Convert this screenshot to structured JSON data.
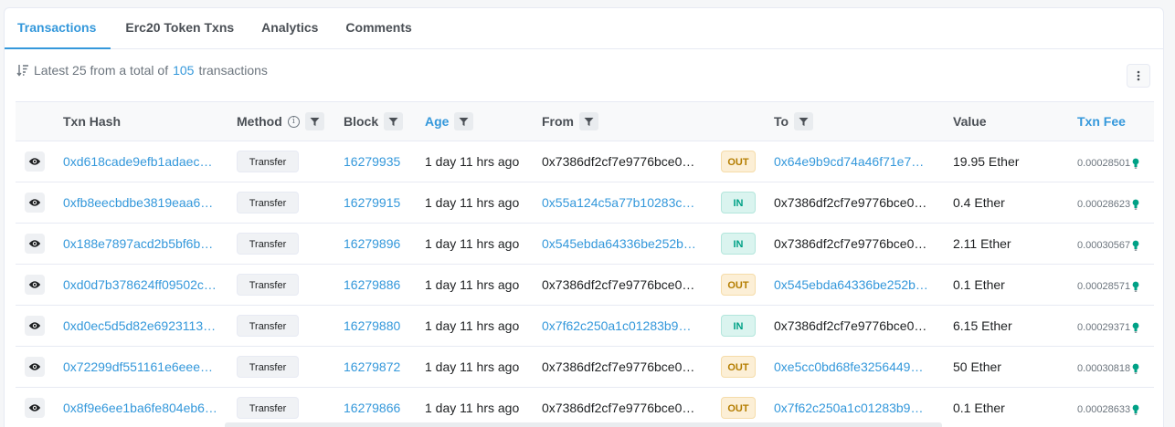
{
  "tabs": [
    {
      "label": "Transactions",
      "active": true
    },
    {
      "label": "Erc20 Token Txns",
      "active": false
    },
    {
      "label": "Analytics",
      "active": false
    },
    {
      "label": "Comments",
      "active": false
    }
  ],
  "summary": {
    "prefix": "Latest 25 from a total of",
    "count": "105",
    "suffix": "transactions"
  },
  "columns": {
    "txn_hash": "Txn Hash",
    "method": "Method",
    "block": "Block",
    "age": "Age",
    "from": "From",
    "to": "To",
    "value": "Value",
    "txn_fee": "Txn Fee"
  },
  "rows": [
    {
      "hash": "0xd618cade9efb1adaec…",
      "method": "Transfer",
      "block": "16279935",
      "age": "1 day 11 hrs ago",
      "from": "0x7386df2cf7e9776bce0…",
      "from_link": false,
      "dir": "OUT",
      "to": "0x64e9b9cd74a46f71e7…",
      "to_link": true,
      "value": "19.95 Ether",
      "fee": "0.00028501"
    },
    {
      "hash": "0xfb8eecbdbe3819eaa6…",
      "method": "Transfer",
      "block": "16279915",
      "age": "1 day 11 hrs ago",
      "from": "0x55a124c5a77b10283c…",
      "from_link": true,
      "dir": "IN",
      "to": "0x7386df2cf7e9776bce0…",
      "to_link": false,
      "value": "0.4 Ether",
      "fee": "0.00028623"
    },
    {
      "hash": "0x188e7897acd2b5bf6b…",
      "method": "Transfer",
      "block": "16279896",
      "age": "1 day 11 hrs ago",
      "from": "0x545ebda64336be252b…",
      "from_link": true,
      "dir": "IN",
      "to": "0x7386df2cf7e9776bce0…",
      "to_link": false,
      "value": "2.11 Ether",
      "fee": "0.00030567"
    },
    {
      "hash": "0xd0d7b378624ff09502c…",
      "method": "Transfer",
      "block": "16279886",
      "age": "1 day 11 hrs ago",
      "from": "0x7386df2cf7e9776bce0…",
      "from_link": false,
      "dir": "OUT",
      "to": "0x545ebda64336be252b…",
      "to_link": true,
      "value": "0.1 Ether",
      "fee": "0.00028571"
    },
    {
      "hash": "0xd0ec5d5d82e6923113…",
      "method": "Transfer",
      "block": "16279880",
      "age": "1 day 11 hrs ago",
      "from": "0x7f62c250a1c01283b9…",
      "from_link": true,
      "dir": "IN",
      "to": "0x7386df2cf7e9776bce0…",
      "to_link": false,
      "value": "6.15 Ether",
      "fee": "0.00029371"
    },
    {
      "hash": "0x72299df551161e6eee…",
      "method": "Transfer",
      "block": "16279872",
      "age": "1 day 11 hrs ago",
      "from": "0x7386df2cf7e9776bce0…",
      "from_link": false,
      "dir": "OUT",
      "to": "0xe5cc0bd68fe3256449…",
      "to_link": true,
      "value": "50 Ether",
      "fee": "0.00030818"
    },
    {
      "hash": "0x8f9e6ee1ba6fe804eb6…",
      "method": "Transfer",
      "block": "16279866",
      "age": "1 day 11 hrs ago",
      "from": "0x7386df2cf7e9776bce0…",
      "from_link": false,
      "dir": "OUT",
      "to": "0x7f62c250a1c01283b9…",
      "to_link": true,
      "value": "0.1 Ether",
      "fee": "0.00028633"
    }
  ],
  "colors": {
    "accent": "#3498db",
    "out": "#b47d00",
    "in": "#00a186",
    "fee_bulb": "#00a186"
  }
}
